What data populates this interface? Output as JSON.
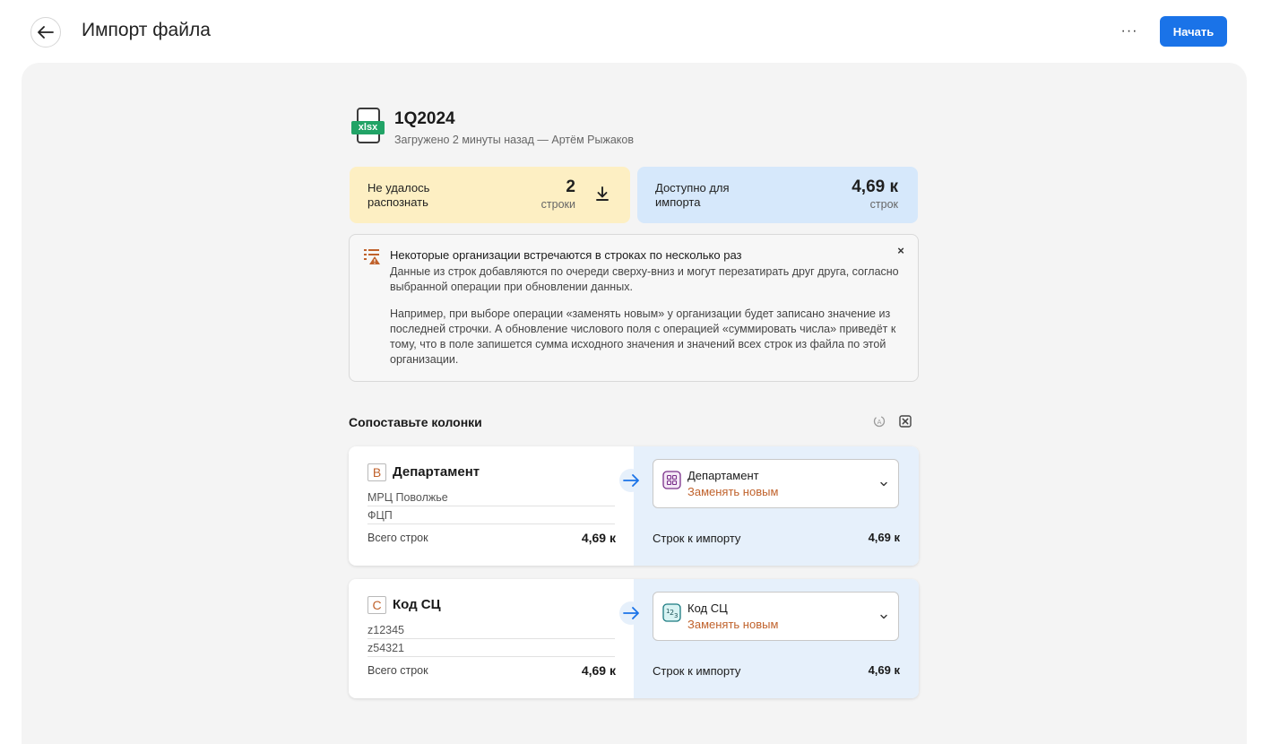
{
  "header": {
    "title": "Импорт файла",
    "more_label": "···",
    "start_label": "Начать"
  },
  "file": {
    "badge": "xlsx",
    "name": "1Q2024",
    "meta": "Загружено 2 минуты назад — Артём Рыжаков"
  },
  "stats": {
    "failed": {
      "label": "Не удалось распознать",
      "value": "2",
      "unit": "строки"
    },
    "available": {
      "label": "Доступно для импорта",
      "value": "4,69 к",
      "unit": "строк"
    }
  },
  "alert": {
    "title": "Некоторые организации встречаются в строках по несколько раз",
    "paragraph1": "Данные из строк добавляются по очереди сверху-вниз и могут перезатирать друг друга, согласно выбранной операции при обновлении данных.",
    "paragraph2": "Например, при выборе операции «заменять новым» у организации будет записано значение из последней строчки. А обновление числового поля с операцией «суммировать числа» приведёт к тому, что в поле запишется сумма исходного значения и значений всех строк из файла по этой организации.",
    "close": "×"
  },
  "mapping": {
    "title": "Сопоставьте колонки",
    "rows": [
      {
        "letter": "B",
        "column": "Департамент",
        "samples": [
          "МРЦ Поволжье",
          "ФЦП"
        ],
        "total_label": "Всего строк",
        "total": "4,69 к",
        "target": "Департамент",
        "operation": "Заменять новым",
        "type_icon": "grid-icon",
        "import_label": "Строк к импорту",
        "import_total": "4,69 к"
      },
      {
        "letter": "C",
        "column": "Код СЦ",
        "samples": [
          "z12345",
          "z54321"
        ],
        "total_label": "Всего строк",
        "total": "4,69 к",
        "target": "Код СЦ",
        "operation": "Заменять новым",
        "type_icon": "number-icon",
        "import_label": "Строк к импорту",
        "import_total": "4,69 к"
      }
    ]
  },
  "colors": {
    "accent": "#1a73e8",
    "warn_bg": "#fdefc3",
    "ok_bg": "#d6e8fb",
    "operation": "#c0622c",
    "xlsx": "#21a366"
  }
}
